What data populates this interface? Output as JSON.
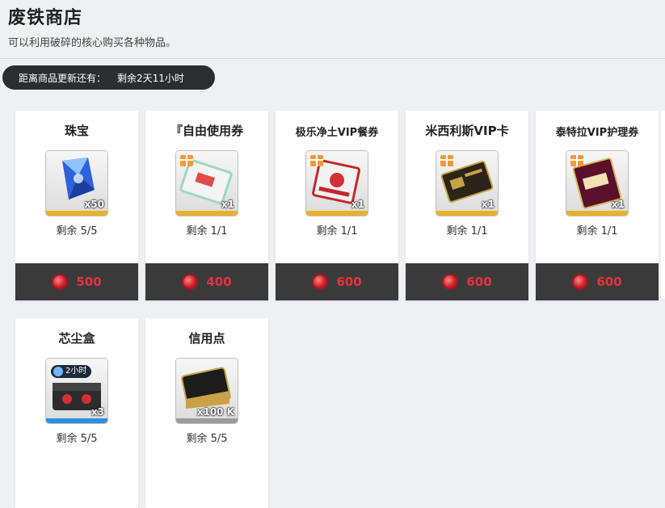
{
  "header": {
    "title": "废铁商店",
    "subtitle": "可以利用破碎的核心购买各种物品。"
  },
  "timer": {
    "label": "距离商品更新还有：",
    "value": "剩余2天11小时"
  },
  "items": [
    {
      "name": "珠宝",
      "icon": "blue-crystal-icon",
      "qty": "x50",
      "remain": "剩余 5/5",
      "price": "500",
      "rarity_color": "#e7b22a"
    },
    {
      "name": "『自由使用券",
      "icon": "ticket-icon",
      "qty": "x1",
      "remain": "剩余 1/1",
      "price": "400",
      "rarity_color": "#e7b22a"
    },
    {
      "name": "极乐净土VIP餐券",
      "icon": "vip-meal-voucher-icon",
      "qty": "x1",
      "remain": "剩余 1/1",
      "price": "600",
      "rarity_color": "#e7b22a"
    },
    {
      "name": "米西利斯VIP卡",
      "icon": "vip-card-icon",
      "qty": "x1",
      "remain": "剩余 1/1",
      "price": "600",
      "rarity_color": "#e7b22a"
    },
    {
      "name": "泰特拉VIP护理券",
      "icon": "beauty-care-voucher-icon",
      "qty": "x1",
      "remain": "剩余 1/1",
      "price": "600",
      "rarity_color": "#e7b22a"
    },
    {
      "name": "芯尘盒",
      "icon": "core-dust-box-icon",
      "badge": "2小时",
      "qty": "x3",
      "remain": "剩余 5/5",
      "price": "",
      "rarity_color": "#2e8fe0"
    },
    {
      "name": "信用点",
      "icon": "credit-card-icon",
      "qty": "x100 K",
      "remain": "剩余 5/5",
      "price": "",
      "rarity_color": "#9c9c9c"
    }
  ],
  "currency": {
    "icon": "broken-core-icon",
    "price_color": "#e8323c"
  }
}
